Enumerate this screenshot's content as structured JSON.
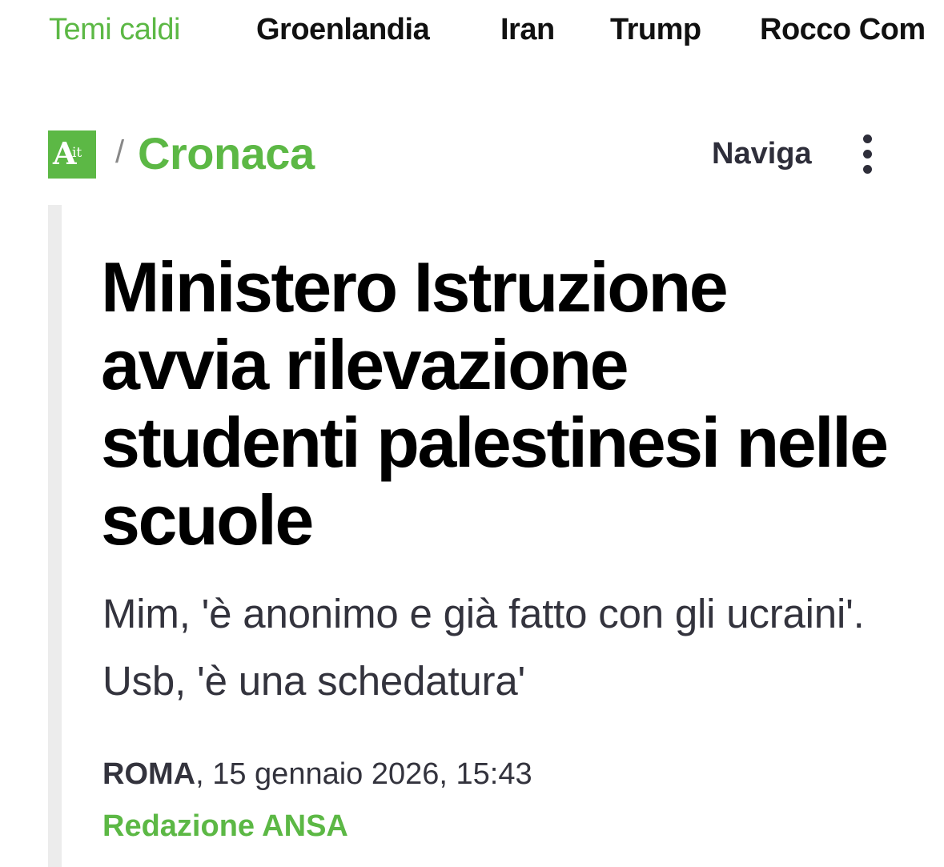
{
  "colors": {
    "accent": "#5cb845",
    "text_dark": "#000000",
    "text_muted": "#33333d"
  },
  "topics_bar": {
    "label": "Temi caldi",
    "items": [
      "Groenlandia",
      "Iran",
      "Trump",
      "Rocco Com"
    ]
  },
  "section_header": {
    "logo_letter": "A",
    "logo_suffix": "it",
    "breadcrumb_separator": "/",
    "section": "Cronaca",
    "nav_label": "Naviga",
    "more_icon": "vertical-ellipsis-icon"
  },
  "article": {
    "headline": "Ministero Istruzione avvia rilevazione studenti palestinesi nelle scuole",
    "subtitle": "Mim, 'è anonimo e già fatto con gli ucraini'. Usb, 'è una schedatura'",
    "dateline_place": "ROMA",
    "dateline_rest": ", 15 gennaio 2026, 15:43",
    "author": "Redazione ANSA"
  }
}
